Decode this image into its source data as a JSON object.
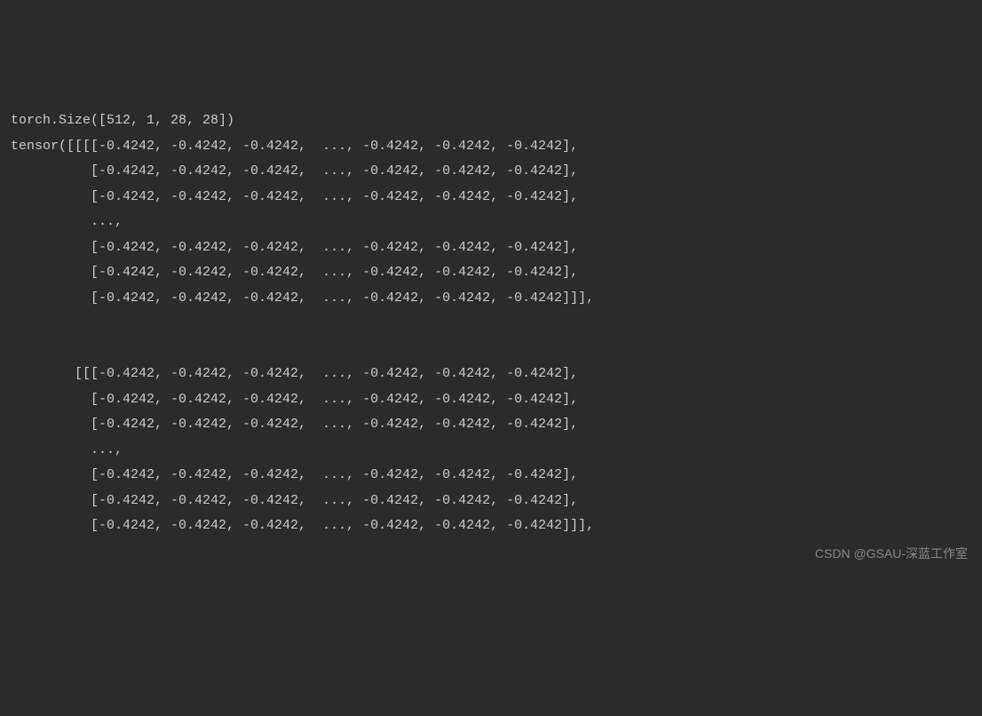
{
  "lines": [
    "torch.Size([512, 1, 28, 28])",
    "tensor([[[[-0.4242, -0.4242, -0.4242,  ..., -0.4242, -0.4242, -0.4242],",
    "          [-0.4242, -0.4242, -0.4242,  ..., -0.4242, -0.4242, -0.4242],",
    "          [-0.4242, -0.4242, -0.4242,  ..., -0.4242, -0.4242, -0.4242],",
    "          ...,",
    "          [-0.4242, -0.4242, -0.4242,  ..., -0.4242, -0.4242, -0.4242],",
    "          [-0.4242, -0.4242, -0.4242,  ..., -0.4242, -0.4242, -0.4242],",
    "          [-0.4242, -0.4242, -0.4242,  ..., -0.4242, -0.4242, -0.4242]]],",
    "",
    "",
    "        [[[-0.4242, -0.4242, -0.4242,  ..., -0.4242, -0.4242, -0.4242],",
    "          [-0.4242, -0.4242, -0.4242,  ..., -0.4242, -0.4242, -0.4242],",
    "          [-0.4242, -0.4242, -0.4242,  ..., -0.4242, -0.4242, -0.4242],",
    "          ...,",
    "          [-0.4242, -0.4242, -0.4242,  ..., -0.4242, -0.4242, -0.4242],",
    "          [-0.4242, -0.4242, -0.4242,  ..., -0.4242, -0.4242, -0.4242],",
    "          [-0.4242, -0.4242, -0.4242,  ..., -0.4242, -0.4242, -0.4242]]],"
  ],
  "watermark": "CSDN @GSAU-深蓝工作室"
}
